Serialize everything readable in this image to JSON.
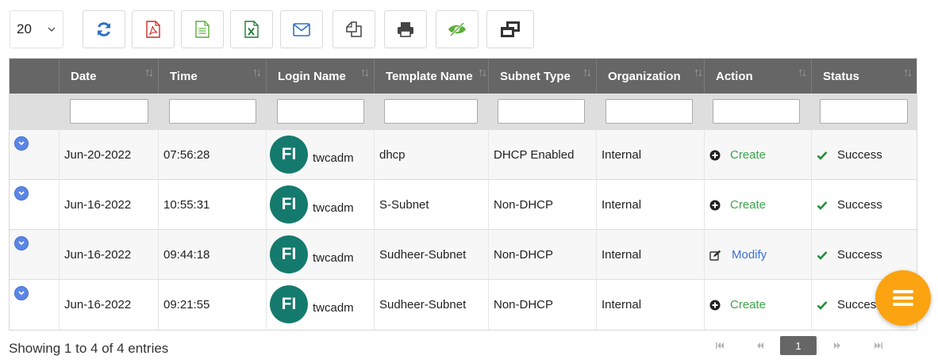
{
  "toolbar": {
    "page_size": "20",
    "buttons": [
      {
        "name": "refresh-button",
        "icon": "refresh-icon",
        "color": "#2e6fc7"
      },
      {
        "name": "export-pdf-button",
        "icon": "pdf-file-icon",
        "color": "#cc2b2b"
      },
      {
        "name": "export-csv-button",
        "icon": "text-file-icon",
        "color": "#5cae3a"
      },
      {
        "name": "export-excel-button",
        "icon": "excel-file-icon",
        "color": "#1e7a35"
      },
      {
        "name": "email-button",
        "icon": "envelope-icon",
        "color": "#2e6fc7"
      },
      {
        "name": "copy-button",
        "icon": "copy-icon",
        "color": "#444444"
      },
      {
        "name": "print-button",
        "icon": "print-icon",
        "color": "#444444"
      },
      {
        "name": "column-visibility-button",
        "icon": "eye-slash-icon",
        "color": "#5cae3a"
      },
      {
        "name": "restore-window-button",
        "icon": "restore-window-icon",
        "color": "#333333"
      }
    ]
  },
  "table": {
    "columns": [
      "",
      "Date",
      "Time",
      "Login Name",
      "Template Name",
      "Subnet Type",
      "Organization",
      "Action",
      "Status"
    ],
    "rows": [
      {
        "date": "Jun-20-2022",
        "time": "07:56:28",
        "avatar": "FI",
        "login": "twcadm",
        "template": "dhcp",
        "subnet_type": "DHCP Enabled",
        "organization": "Internal",
        "action": "Create",
        "action_icon": "plus-circle-icon",
        "status": "Success"
      },
      {
        "date": "Jun-16-2022",
        "time": "10:55:31",
        "avatar": "FI",
        "login": "twcadm",
        "template": "S-Subnet",
        "subnet_type": "Non-DHCP",
        "organization": "Internal",
        "action": "Create",
        "action_icon": "plus-circle-icon",
        "status": "Success"
      },
      {
        "date": "Jun-16-2022",
        "time": "09:44:18",
        "avatar": "FI",
        "login": "twcadm",
        "template": "Sudheer-Subnet",
        "subnet_type": "Non-DHCP",
        "organization": "Internal",
        "action": "Modify",
        "action_icon": "edit-icon",
        "status": "Success"
      },
      {
        "date": "Jun-16-2022",
        "time": "09:21:55",
        "avatar": "FI",
        "login": "twcadm",
        "template": "Sudheer-Subnet",
        "subnet_type": "Non-DHCP",
        "organization": "Internal",
        "action": "Create",
        "action_icon": "plus-circle-icon",
        "status": "Success"
      }
    ]
  },
  "footer": {
    "info": "Showing 1 to 4 of 4 entries",
    "current_page": "1"
  },
  "colors": {
    "header_bg": "#666666",
    "avatar_bg": "#157a6e",
    "create": "#3aa64b",
    "modify": "#3d6fd8",
    "fab": "#fca311"
  }
}
